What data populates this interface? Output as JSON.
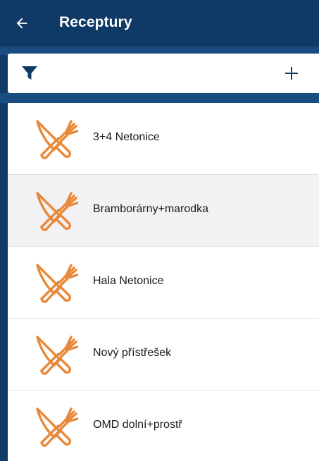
{
  "header": {
    "title": "Receptury",
    "back_icon": "arrow-left-icon",
    "color": "#0f3a66"
  },
  "toolbar": {
    "filter_icon": "filter-icon",
    "add_icon": "plus-icon"
  },
  "accent_color": "#e8893a",
  "recipes": {
    "items": [
      {
        "label": "3+4 Netonice",
        "icon": "cutlery-icon"
      },
      {
        "label": "Bramborárny+marodka",
        "icon": "cutlery-icon"
      },
      {
        "label": "Hala Netonice",
        "icon": "cutlery-icon"
      },
      {
        "label": "Nový přístřešek",
        "icon": "cutlery-icon"
      },
      {
        "label": "OMD dolní+prostř",
        "icon": "cutlery-icon"
      }
    ]
  }
}
